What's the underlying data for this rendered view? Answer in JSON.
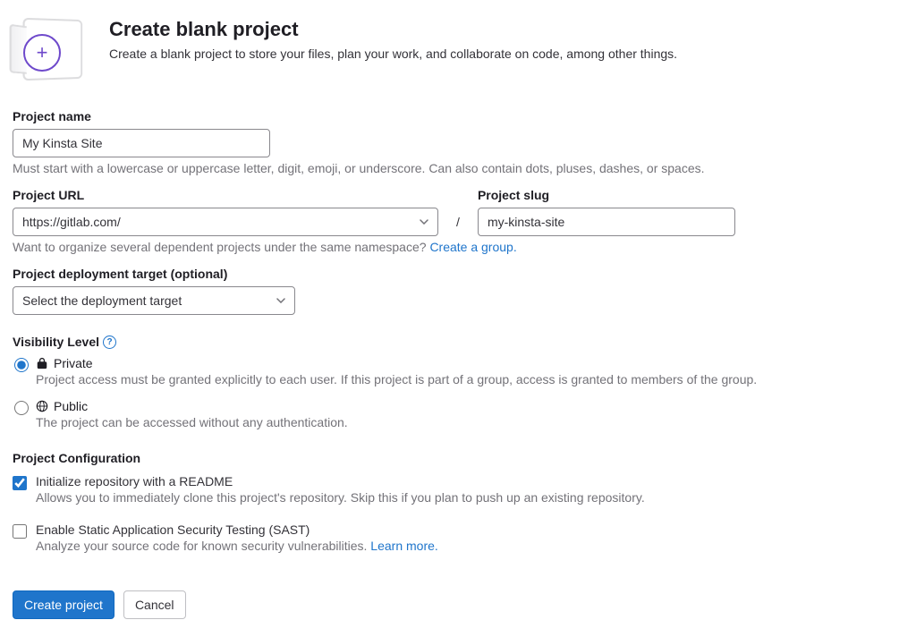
{
  "header": {
    "title": "Create blank project",
    "subtitle": "Create a blank project to store your files, plan your work, and collaborate on code, among other things."
  },
  "project_name": {
    "label": "Project name",
    "value": "My Kinsta Site",
    "help": "Must start with a lowercase or uppercase letter, digit, emoji, or underscore. Can also contain dots, pluses, dashes, or spaces."
  },
  "project_url": {
    "label": "Project URL",
    "value": "https://gitlab.com/"
  },
  "slash": "/",
  "project_slug": {
    "label": "Project slug",
    "value": "my-kinsta-site"
  },
  "namespace_help": {
    "text": "Want to organize several dependent projects under the same namespace? ",
    "link": "Create a group."
  },
  "deployment": {
    "label": "Project deployment target (optional)",
    "placeholder": "Select the deployment target"
  },
  "visibility": {
    "label": "Visibility Level",
    "options": {
      "private": {
        "title": "Private",
        "desc": "Project access must be granted explicitly to each user. If this project is part of a group, access is granted to members of the group.",
        "selected": true
      },
      "public": {
        "title": "Public",
        "desc": "The project can be accessed without any authentication.",
        "selected": false
      }
    }
  },
  "config": {
    "label": "Project Configuration",
    "readme": {
      "title": "Initialize repository with a README",
      "desc": "Allows you to immediately clone this project's repository. Skip this if you plan to push up an existing repository.",
      "checked": true
    },
    "sast": {
      "title": "Enable Static Application Security Testing (SAST)",
      "desc_prefix": "Analyze your source code for known security vulnerabilities. ",
      "desc_link": "Learn more.",
      "checked": false
    }
  },
  "buttons": {
    "create": "Create project",
    "cancel": "Cancel"
  }
}
